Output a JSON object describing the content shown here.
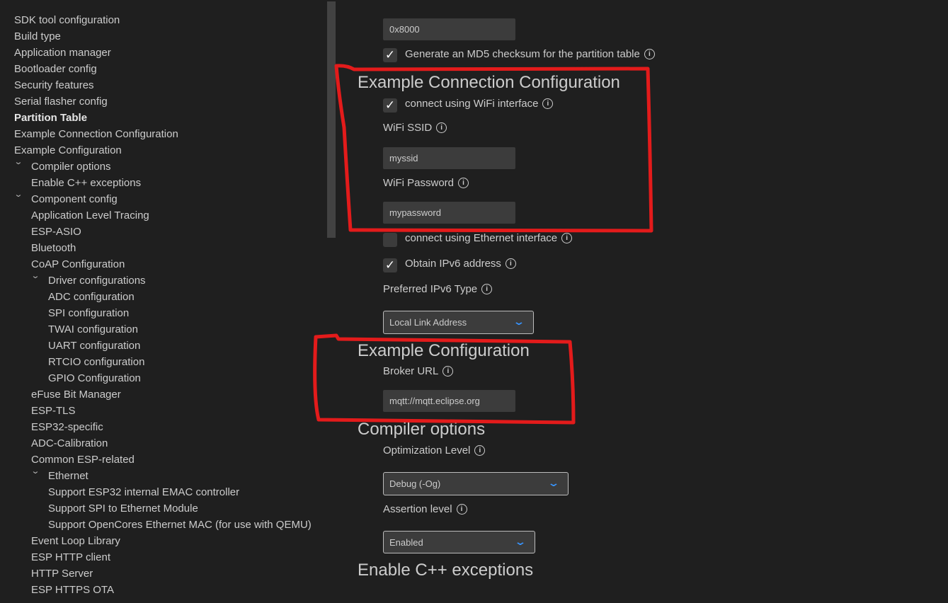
{
  "sidebar": {
    "items": [
      {
        "label": "SDK tool configuration",
        "level": 0
      },
      {
        "label": "Build type",
        "level": 0
      },
      {
        "label": "Application manager",
        "level": 0
      },
      {
        "label": "Bootloader config",
        "level": 0
      },
      {
        "label": "Security features",
        "level": 0
      },
      {
        "label": "Serial flasher config",
        "level": 0
      },
      {
        "label": "Partition Table",
        "level": 0,
        "active": true
      },
      {
        "label": "Example Connection Configuration",
        "level": 0
      },
      {
        "label": "Example Configuration",
        "level": 0
      },
      {
        "label": "Compiler options",
        "level": 0,
        "expanded": true
      },
      {
        "label": "Enable C++ exceptions",
        "level": 1
      },
      {
        "label": "Component config",
        "level": 0,
        "expanded": true
      },
      {
        "label": "Application Level Tracing",
        "level": 1
      },
      {
        "label": "ESP-ASIO",
        "level": 1
      },
      {
        "label": "Bluetooth",
        "level": 1
      },
      {
        "label": "CoAP Configuration",
        "level": 1
      },
      {
        "label": "Driver configurations",
        "level": 1,
        "expanded": true
      },
      {
        "label": "ADC configuration",
        "level": 2
      },
      {
        "label": "SPI configuration",
        "level": 2
      },
      {
        "label": "TWAI configuration",
        "level": 2
      },
      {
        "label": "UART configuration",
        "level": 2
      },
      {
        "label": "RTCIO configuration",
        "level": 2
      },
      {
        "label": "GPIO Configuration",
        "level": 2
      },
      {
        "label": "eFuse Bit Manager",
        "level": 1
      },
      {
        "label": "ESP-TLS",
        "level": 1
      },
      {
        "label": "ESP32-specific",
        "level": 1
      },
      {
        "label": "ADC-Calibration",
        "level": 1
      },
      {
        "label": "Common ESP-related",
        "level": 1
      },
      {
        "label": "Ethernet",
        "level": 1,
        "expanded": true
      },
      {
        "label": "Support ESP32 internal EMAC controller",
        "level": 2
      },
      {
        "label": "Support SPI to Ethernet Module",
        "level": 2
      },
      {
        "label": "Support OpenCores Ethernet MAC (for use with QEMU)",
        "level": 2
      },
      {
        "label": "Event Loop Library",
        "level": 1
      },
      {
        "label": "ESP HTTP client",
        "level": 1
      },
      {
        "label": "HTTP Server",
        "level": 1
      },
      {
        "label": "ESP HTTPS OTA",
        "level": 1
      }
    ],
    "chevron_glyph": "⌄"
  },
  "main": {
    "partition_table": {
      "offset_value": "0x8000",
      "md5_label": "Generate an MD5 checksum for the partition table",
      "md5_checked": true
    },
    "example_connection": {
      "title": "Example Connection Configuration",
      "wifi_iface_label": "connect using WiFi interface",
      "wifi_iface_checked": true,
      "ssid_label": "WiFi SSID",
      "ssid_value": "myssid",
      "password_label": "WiFi Password",
      "password_value": "mypassword",
      "eth_iface_label": "connect using Ethernet interface",
      "eth_iface_checked": false,
      "ipv6_label": "Obtain IPv6 address",
      "ipv6_checked": true,
      "ipv6_type_label": "Preferred IPv6 Type",
      "ipv6_type_value": "Local Link Address"
    },
    "example_config": {
      "title": "Example Configuration",
      "broker_label": "Broker URL",
      "broker_value": "mqtt://mqtt.eclipse.org"
    },
    "compiler_options": {
      "title": "Compiler options",
      "opt_label": "Optimization Level",
      "opt_value": "Debug (-Og)",
      "assert_label": "Assertion level",
      "assert_value": "Enabled"
    },
    "cpp_exceptions": {
      "title": "Enable C++ exceptions"
    }
  },
  "icons": {
    "info": "i",
    "check": "✓",
    "dropdown": "⌄"
  },
  "colors": {
    "background": "#1f1f1f",
    "input_bg": "#3c3c3c",
    "accent": "#3794ff",
    "annotation": "#e31b1b"
  }
}
